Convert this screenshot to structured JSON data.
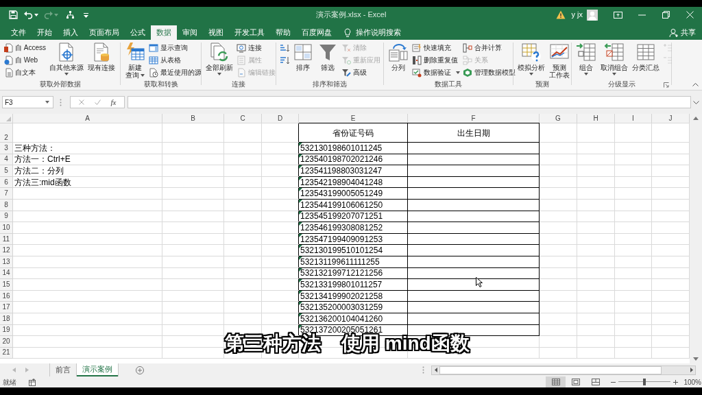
{
  "title_bar": {
    "title": "演示案例.xlsx - Excel",
    "user": "y jx"
  },
  "menu_tabs": [
    {
      "label": "文件",
      "selected": false
    },
    {
      "label": "开始",
      "selected": false
    },
    {
      "label": "插入",
      "selected": false
    },
    {
      "label": "页面布局",
      "selected": false
    },
    {
      "label": "公式",
      "selected": false
    },
    {
      "label": "数据",
      "selected": true
    },
    {
      "label": "审阅",
      "selected": false
    },
    {
      "label": "视图",
      "selected": false
    },
    {
      "label": "开发工具",
      "selected": false
    },
    {
      "label": "帮助",
      "selected": false
    },
    {
      "label": "百度网盘",
      "selected": false
    }
  ],
  "tell_me": "操作说明搜索",
  "share": "共享",
  "ribbon": [
    {
      "label": "获取外部数据",
      "dialog_launcher": false,
      "items": [
        {
          "kind": "small",
          "label": "自 Access",
          "dropdown": false,
          "disabled": false
        },
        {
          "kind": "small",
          "label": "自 Web",
          "dropdown": false,
          "disabled": false
        },
        {
          "kind": "small",
          "label": "自文本",
          "dropdown": false,
          "disabled": false
        },
        {
          "kind": "large",
          "lines": [
            "自其他来源"
          ],
          "dropdown": true,
          "disabled": false
        },
        {
          "kind": "large",
          "lines": [
            "现有连接"
          ],
          "dropdown": false,
          "disabled": false
        }
      ]
    },
    {
      "label": "获取和转换",
      "dialog_launcher": false,
      "items": [
        {
          "kind": "large",
          "lines": [
            "新建",
            "查询"
          ],
          "dropdown": true,
          "disabled": false
        },
        {
          "kind": "small",
          "label": "显示查询",
          "dropdown": false,
          "disabled": false
        },
        {
          "kind": "small",
          "label": "从表格",
          "dropdown": false,
          "disabled": false
        },
        {
          "kind": "small",
          "label": "最近使用的源",
          "dropdown": false,
          "disabled": false
        }
      ]
    },
    {
      "label": "连接",
      "dialog_launcher": false,
      "items": [
        {
          "kind": "large",
          "lines": [
            "全部刷新"
          ],
          "dropdown": true,
          "disabled": false
        },
        {
          "kind": "small",
          "label": "连接",
          "dropdown": false,
          "disabled": false
        },
        {
          "kind": "small",
          "label": "属性",
          "dropdown": false,
          "disabled": true
        },
        {
          "kind": "small",
          "label": "编辑链接",
          "dropdown": false,
          "disabled": true
        }
      ]
    },
    {
      "label": "排序和筛选",
      "dialog_launcher": false,
      "items": [
        {
          "kind": "icon",
          "disabled": false
        },
        {
          "kind": "icon",
          "disabled": false
        },
        {
          "kind": "large",
          "lines": [
            "排序"
          ],
          "dropdown": false,
          "disabled": false
        },
        {
          "kind": "large",
          "lines": [
            "筛选"
          ],
          "dropdown": false,
          "disabled": false
        },
        {
          "kind": "small",
          "label": "清除",
          "dropdown": false,
          "disabled": true
        },
        {
          "kind": "small",
          "label": "重新应用",
          "dropdown": false,
          "disabled": true
        },
        {
          "kind": "small",
          "label": "高级",
          "dropdown": false,
          "disabled": false
        }
      ]
    },
    {
      "label": "数据工具",
      "dialog_launcher": false,
      "items": [
        {
          "kind": "large",
          "lines": [
            "分列"
          ],
          "dropdown": false,
          "disabled": false
        },
        {
          "kind": "small",
          "label": "快速填充",
          "dropdown": false,
          "disabled": false
        },
        {
          "kind": "small",
          "label": "删除重复值",
          "dropdown": false,
          "disabled": false
        },
        {
          "kind": "small",
          "label": "数据验证",
          "dropdown": true,
          "disabled": false
        },
        {
          "kind": "small",
          "label": "合并计算",
          "dropdown": false,
          "disabled": false
        },
        {
          "kind": "small",
          "label": "关系",
          "dropdown": false,
          "disabled": true
        },
        {
          "kind": "small",
          "label": "管理数据模型",
          "dropdown": false,
          "disabled": false
        }
      ]
    },
    {
      "label": "预测",
      "dialog_launcher": false,
      "items": [
        {
          "kind": "large",
          "lines": [
            "模拟分析"
          ],
          "dropdown": true,
          "disabled": false
        },
        {
          "kind": "large",
          "lines": [
            "预测",
            "工作表"
          ],
          "dropdown": false,
          "disabled": false
        }
      ]
    },
    {
      "label": "分级显示",
      "dialog_launcher": true,
      "items": [
        {
          "kind": "large",
          "lines": [
            "组合"
          ],
          "dropdown": true,
          "disabled": false
        },
        {
          "kind": "large",
          "lines": [
            "取消组合"
          ],
          "dropdown": true,
          "disabled": false
        },
        {
          "kind": "large",
          "lines": [
            "分类汇总"
          ],
          "dropdown": false,
          "disabled": false
        },
        {
          "kind": "icon",
          "disabled": true
        },
        {
          "kind": "icon",
          "disabled": true
        }
      ]
    }
  ],
  "formula_bar": {
    "name_box": "F3",
    "insert_function": "fx"
  },
  "columns": [
    "A",
    "B",
    "C",
    "D",
    "E",
    "F",
    "G",
    "H",
    "I",
    "J"
  ],
  "rows": [
    {
      "number": "2",
      "kind": "heading",
      "boxed": true,
      "flag": false,
      "cells": {
        "e": "省份证号码",
        "f": "出生日期"
      }
    },
    {
      "number": "3",
      "kind": "plain",
      "boxed": true,
      "flag": true,
      "cells": {
        "a": "三种方法：",
        "e": "532130198601011245"
      }
    },
    {
      "number": "4",
      "kind": "plain",
      "boxed": true,
      "flag": true,
      "cells": {
        "a": "方法一：Ctrl+E",
        "e": "123540198702021246"
      }
    },
    {
      "number": "5",
      "kind": "plain",
      "boxed": true,
      "flag": true,
      "cells": {
        "a": "方法二：分列",
        "e": "123541198803031247"
      }
    },
    {
      "number": "6",
      "kind": "plain",
      "boxed": true,
      "flag": true,
      "cells": {
        "a": "方法三:mid函数",
        "e": "123542198904041248"
      }
    },
    {
      "number": "7",
      "kind": "plain",
      "boxed": true,
      "flag": true,
      "cells": {
        "e": "123543199005051249"
      }
    },
    {
      "number": "8",
      "kind": "plain",
      "boxed": true,
      "flag": true,
      "cells": {
        "e": "123544199106061250"
      }
    },
    {
      "number": "9",
      "kind": "plain",
      "boxed": true,
      "flag": true,
      "cells": {
        "e": "123545199207071251"
      }
    },
    {
      "number": "10",
      "kind": "plain",
      "boxed": true,
      "flag": true,
      "cells": {
        "e": "123546199308081252"
      }
    },
    {
      "number": "11",
      "kind": "plain",
      "boxed": true,
      "flag": true,
      "cells": {
        "e": "123547199409091253"
      }
    },
    {
      "number": "12",
      "kind": "plain",
      "boxed": true,
      "flag": true,
      "cells": {
        "e": "532130199510101254"
      }
    },
    {
      "number": "13",
      "kind": "plain",
      "boxed": true,
      "flag": true,
      "cells": {
        "e": "532131199611111255"
      }
    },
    {
      "number": "14",
      "kind": "plain",
      "boxed": true,
      "flag": true,
      "cells": {
        "e": "532132199712121256"
      }
    },
    {
      "number": "15",
      "kind": "plain",
      "boxed": true,
      "flag": true,
      "cells": {
        "e": "532133199801011257"
      }
    },
    {
      "number": "16",
      "kind": "plain",
      "boxed": true,
      "flag": true,
      "cells": {
        "e": "532134199902021258"
      }
    },
    {
      "number": "17",
      "kind": "plain",
      "boxed": true,
      "flag": true,
      "cells": {
        "e": "532135200003031259"
      }
    },
    {
      "number": "18",
      "kind": "plain",
      "boxed": true,
      "flag": true,
      "cells": {
        "e": "532136200104041260"
      }
    },
    {
      "number": "19",
      "kind": "plain",
      "boxed": true,
      "flag": true,
      "cells": {
        "e": "532137200205051261"
      }
    },
    {
      "number": "20",
      "kind": "plain",
      "boxed": false,
      "flag": false
    },
    {
      "number": "21",
      "kind": "plain",
      "boxed": false,
      "flag": false
    }
  ],
  "sheet_tabs": [
    {
      "label": "前言",
      "selected": false
    },
    {
      "label": "演示案例",
      "selected": true
    }
  ],
  "status_bar": {
    "status": "就绪",
    "views": [
      {
        "selected": true
      },
      {
        "selected": false
      },
      {
        "selected": false
      }
    ],
    "zoom": {
      "level": 0.5,
      "reading": "100%"
    }
  },
  "subtitle": [
    "第三种方法",
    "使用 mind函数"
  ]
}
